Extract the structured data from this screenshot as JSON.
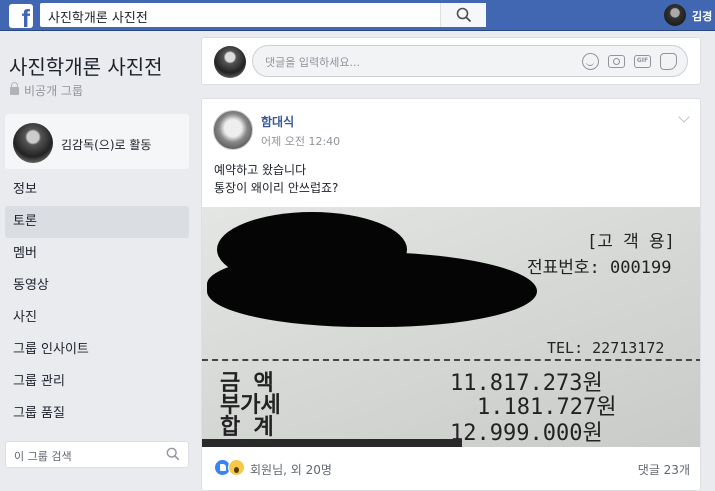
{
  "topbar": {
    "search_value": "사진학개론 사진전",
    "user_name": "김경"
  },
  "group": {
    "title": "사진학개론 사진전",
    "privacy": "비공개 그룹",
    "acting_as": "김감독(으)로 활동",
    "nav": [
      {
        "label": "정보",
        "active": false
      },
      {
        "label": "토론",
        "active": true
      },
      {
        "label": "멤버",
        "active": false
      },
      {
        "label": "동영상",
        "active": false
      },
      {
        "label": "사진",
        "active": false
      },
      {
        "label": "그룹 인사이트",
        "active": false
      },
      {
        "label": "그룹 관리",
        "active": false
      },
      {
        "label": "그룹 품질",
        "active": false
      }
    ],
    "search_placeholder": "이 그룹 검색"
  },
  "composer": {
    "placeholder": "댓글을 입력하세요..."
  },
  "post": {
    "author": "함대식",
    "time": "어제 오전 12:40",
    "lines": [
      "예약하고 왔습니다",
      "통장이 왜이리 안쓰럽죠?"
    ],
    "receipt": {
      "copy_label": "[고 객 용]",
      "slip_number": "전표번호: 000199",
      "tel": "TEL: 22713172",
      "rows": [
        {
          "label": "금    액",
          "amount": "11.817.273원"
        },
        {
          "label": "부가세",
          "amount": "1.181.727원"
        },
        {
          "label": "합    계",
          "amount": "12.999.000원"
        }
      ]
    },
    "reactions_text": "회원님, 외 20명",
    "comments": "댓글 23개"
  }
}
